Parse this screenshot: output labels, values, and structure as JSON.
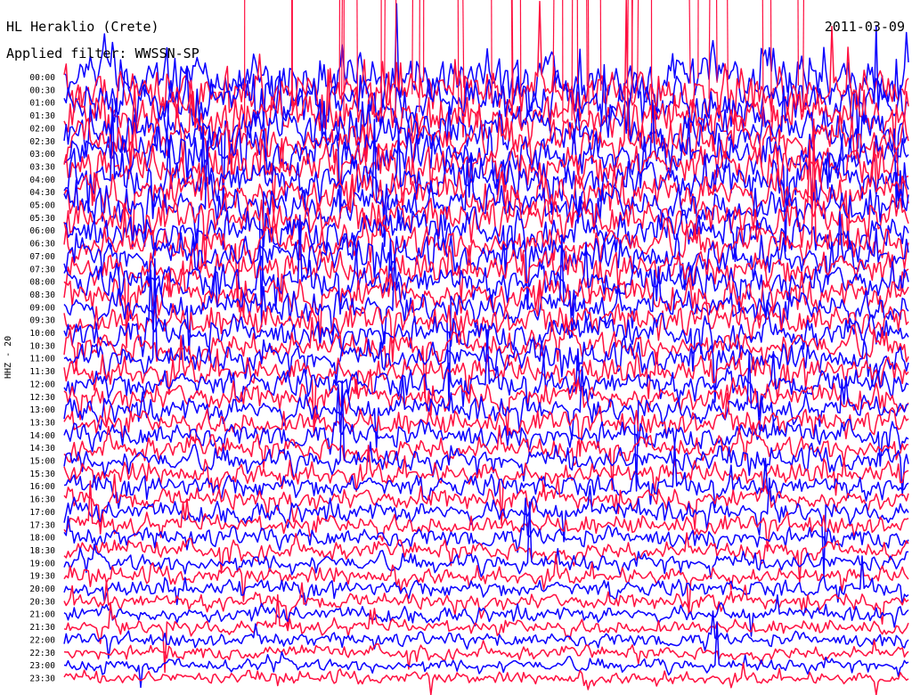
{
  "header": {
    "station_title": "HL Heraklio (Crete)",
    "date": "2011-03-09",
    "filter": "Applied filter: WWSSN-SP"
  },
  "channel_label": "HHZ - 20",
  "colors": {
    "trace_a": "#ff1040",
    "trace_b": "#0a00ff",
    "text": "#000000",
    "background": "#ffffff"
  },
  "chart_data": {
    "type": "line",
    "description_kind": "helicorder",
    "row_interval_minutes": 30,
    "row_labels": [
      "00:00",
      "00:30",
      "01:00",
      "01:30",
      "02:00",
      "02:30",
      "03:00",
      "03:30",
      "04:00",
      "04:30",
      "05:00",
      "05:30",
      "06:00",
      "06:30",
      "07:00",
      "07:30",
      "08:00",
      "08:30",
      "09:00",
      "09:30",
      "10:00",
      "10:30",
      "11:00",
      "11:30",
      "12:00",
      "12:30",
      "13:00",
      "13:30",
      "14:00",
      "14:30",
      "15:00",
      "15:30",
      "16:00",
      "16:30",
      "17:00",
      "17:30",
      "18:00",
      "18:30",
      "19:00",
      "19:30",
      "20:00",
      "20:30",
      "21:00",
      "21:30",
      "22:00",
      "22:30",
      "23:00",
      "23:30"
    ],
    "series": [
      {
        "color_key": "trace_b"
      },
      {
        "color_key": "trace_a"
      }
    ]
  }
}
